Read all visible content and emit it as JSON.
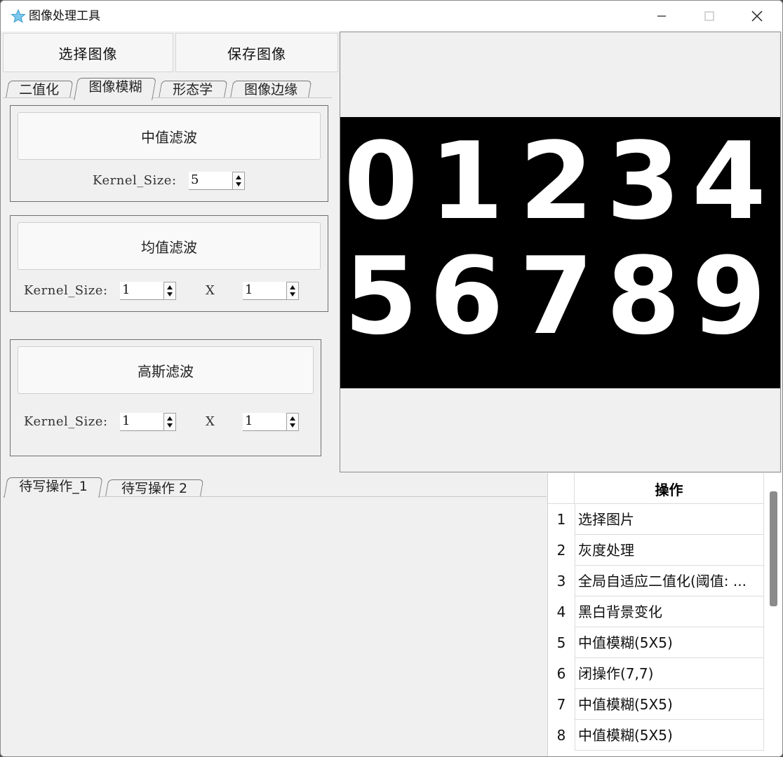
{
  "window": {
    "title": "图像处理工具"
  },
  "toolbar": {
    "select_image": "选择图像",
    "save_image": "保存图像"
  },
  "tabs": [
    "二值化",
    "图像模糊",
    "形态学",
    "图像边缘"
  ],
  "active_tab": "图像模糊",
  "median_filter": {
    "label": "中值滤波",
    "kernel_label": "Kernel_Size:",
    "kernel_value": "5"
  },
  "mean_filter": {
    "label": "均值滤波",
    "kernel_label": "Kernel_Size:",
    "kernel_x": "1",
    "x_sep": "X",
    "kernel_y": "1"
  },
  "gaussian_filter": {
    "label": "高斯滤波",
    "kernel_label": "Kernel_Size:",
    "kernel_x": "1",
    "x_sep": "X",
    "kernel_y": "1"
  },
  "preview": {
    "digits_row1": [
      "0",
      "1",
      "2",
      "3",
      "4"
    ],
    "digits_row2": [
      "5",
      "6",
      "7",
      "8",
      "9"
    ],
    "background": "#000000",
    "foreground": "#ffffff"
  },
  "bottom_tabs": [
    "待写操作_1",
    "待写操作 2"
  ],
  "operations": {
    "header": "操作",
    "rows": [
      {
        "index": "1",
        "text": "选择图片"
      },
      {
        "index": "2",
        "text": "灰度处理"
      },
      {
        "index": "3",
        "text": "全局自适应二值化(阈值: ..."
      },
      {
        "index": "4",
        "text": "黑白背景变化"
      },
      {
        "index": "5",
        "text": "中值模糊(5X5)"
      },
      {
        "index": "6",
        "text": "闭操作(7,7)"
      },
      {
        "index": "7",
        "text": "中值模糊(5X5)"
      },
      {
        "index": "8",
        "text": "中值模糊(5X5)"
      }
    ]
  },
  "icons": {
    "app": "star-icon",
    "minimize": "minimize-icon",
    "maximize": "maximize-icon",
    "close": "close-icon"
  }
}
